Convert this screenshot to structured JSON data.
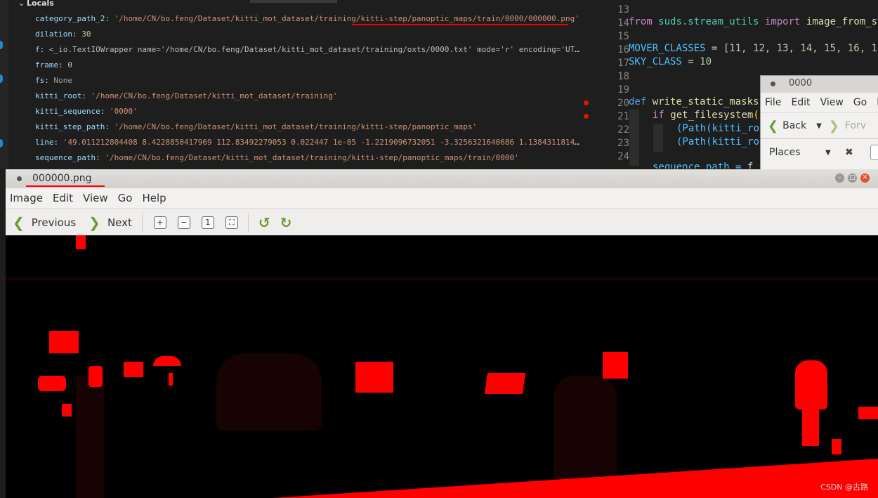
{
  "locals": {
    "header": "Locals",
    "rows": [
      {
        "key": "category_path_2",
        "value": "'/home/CN/bo.feng/Dataset/kitti_mot_dataset/training/kitti-step/panoptic_maps/train/0000/000000.png'",
        "type": "str"
      },
      {
        "key": "dilation",
        "value": "30",
        "type": "num"
      },
      {
        "key": "f",
        "value": "<_io.TextIOWrapper name='/home/CN/bo.feng/Dataset/kitti_mot_dataset/training/oxts/0000.txt' mode='r' encoding='UTF-...",
        "type": "obj"
      },
      {
        "key": "frame",
        "value": "0",
        "type": "num"
      },
      {
        "key": "fs",
        "value": "None",
        "type": "none"
      },
      {
        "key": "kitti_root",
        "value": "'/home/CN/bo.feng/Dataset/kitti_mot_dataset/training'",
        "type": "str"
      },
      {
        "key": "kitti_sequence",
        "value": "'0000'",
        "type": "str"
      },
      {
        "key": "kitti_step_path",
        "value": "'/home/CN/bo.feng/Dataset/kitti_mot_dataset/training/kitti-step/panoptic_maps'",
        "type": "str"
      },
      {
        "key": "line",
        "value": "'49.011212804408 8.4228850417969 112.83492279053 0.022447 1e-05 -1.2219096732051 -3.3256321640686 1.138431181459...",
        "type": "str"
      },
      {
        "key": "sequence_path",
        "value": "'/home/CN/bo.feng/Dataset/kitti_mot_dataset/training/kitti-step/panoptic_maps/train/0000'",
        "type": "str"
      }
    ]
  },
  "editor": {
    "line_numbers": [
      "13",
      "14",
      "15",
      "16",
      "17",
      "18",
      "19",
      "20",
      "21",
      "22",
      "23",
      "24"
    ],
    "line14": {
      "from": "from",
      "module": "suds.stream_utils",
      "import": "import",
      "name": "image_from_s"
    },
    "line16": {
      "name": "MOVER_CLASSES",
      "rest": "= [11, 12, 13, 14, 15, 16, 1"
    },
    "line17": {
      "name": "SKY_CLASS",
      "rest": "= 10"
    },
    "line20": {
      "def": "def",
      "fn": "write_static_masks"
    },
    "line21": {
      "if": "if",
      "fn": "get_filesystem",
      "paren": "("
    },
    "line22": {
      "text": "(Path(kitti_ro"
    },
    "line23": {
      "text": "(Path(kitti_ro"
    },
    "line24": {
      "text": "sequence_path = ",
      "brace": "f"
    }
  },
  "nautilus": {
    "title": "0000",
    "menu": [
      "File",
      "Edit",
      "View",
      "Go",
      "B"
    ],
    "back": "Back",
    "forward": "Forv",
    "places": "Places"
  },
  "viewer": {
    "title": "000000.png",
    "menu": [
      "Image",
      "Edit",
      "View",
      "Go",
      "Help"
    ],
    "previous": "Previous",
    "next": "Next",
    "watermark": "CSDN @古路"
  }
}
